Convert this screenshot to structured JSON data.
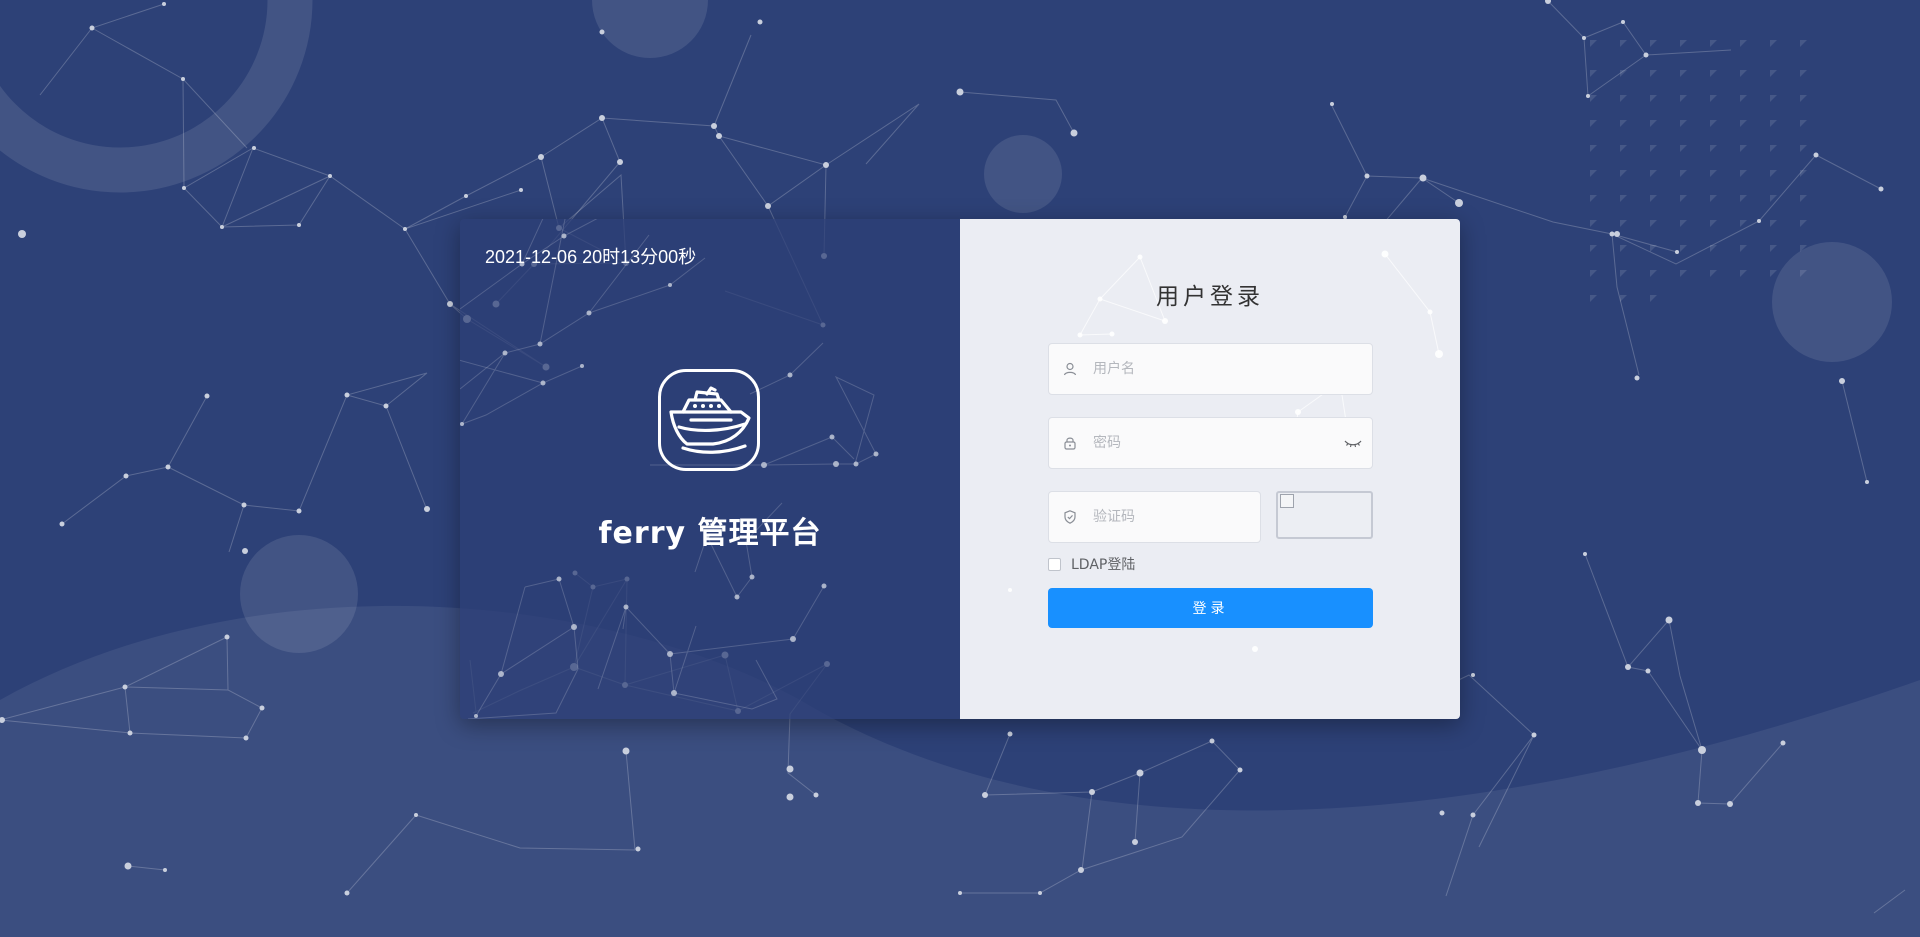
{
  "left_panel": {
    "datetime": "2021-12-06 20时13分00秒",
    "brand_title": "ferry 管理平台",
    "logo_icon": "ship-icon"
  },
  "login_form": {
    "title": "用户登录",
    "username": {
      "placeholder": "用户名",
      "value": "",
      "icon": "user-icon"
    },
    "password": {
      "placeholder": "密码",
      "value": "",
      "icon": "lock-icon",
      "toggle_icon": "eye-closed-icon"
    },
    "captcha": {
      "placeholder": "验证码",
      "value": "",
      "icon": "shield-icon",
      "image_icon": "broken-image-icon"
    },
    "ldap_label": "LDAP登陆",
    "ldap_checked": false,
    "submit_label": "登录"
  },
  "colors": {
    "background": "#2d4177",
    "panel": "#ebedf3",
    "primary": "#1890ff"
  }
}
